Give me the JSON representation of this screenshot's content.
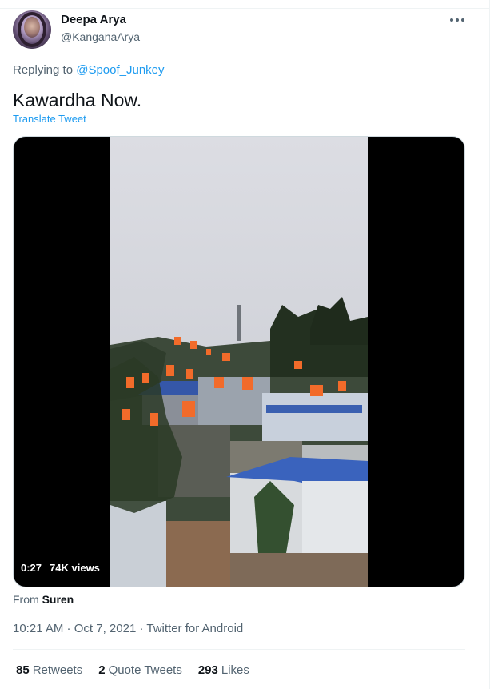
{
  "author": {
    "display_name": "Deepa Arya",
    "handle": "@KanganaArya",
    "avatar_icon": "avatar-portrait"
  },
  "more_icon": "more-horizontal-icon",
  "reply": {
    "prefix": "Replying to ",
    "to_handle": "@Spoof_Junkey"
  },
  "tweet": {
    "text": "Kawardha Now.",
    "translate_label": "Translate Tweet"
  },
  "video": {
    "duration": "0:27",
    "views": "74K views"
  },
  "source": {
    "prefix": "From ",
    "name": "Suren"
  },
  "meta": {
    "time": "10:21 AM",
    "separator": " · ",
    "date": "Oct 7, 2021",
    "client": "Twitter for Android"
  },
  "stats": {
    "retweets_count": "85",
    "retweets_label": "Retweets",
    "quotes_count": "2",
    "quotes_label": "Quote Tweets",
    "likes_count": "293",
    "likes_label": "Likes"
  },
  "colors": {
    "link": "#1d9bf0",
    "muted": "#536471",
    "flag": "#f26b2a"
  }
}
